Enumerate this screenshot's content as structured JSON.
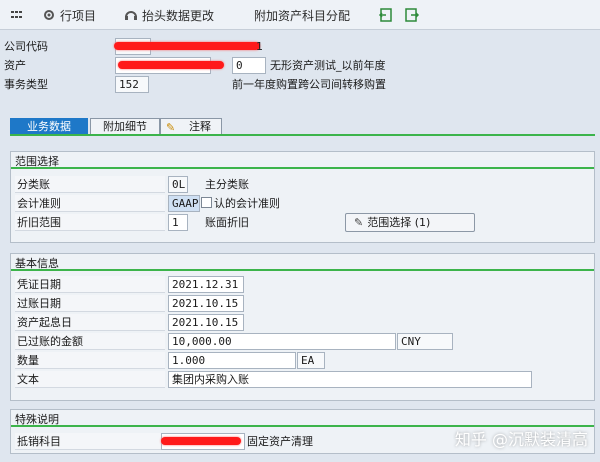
{
  "toolbar": {
    "line_items": "行项目",
    "header_change": "抬头数据更改",
    "additional_assignment": "附加资产科目分配"
  },
  "header": {
    "company_code_label": "公司代码",
    "company_code_suffix": "1",
    "asset_label": "资产",
    "asset_sub": "0",
    "asset_desc": "无形资产测试_以前年度",
    "transaction_type_label": "事务类型",
    "transaction_type_value": "152",
    "transaction_type_desc": "前一年度购置跨公司间转移购置"
  },
  "tabs": [
    {
      "label": "业务数据",
      "active": true
    },
    {
      "label": "附加细节",
      "active": false
    },
    {
      "label": "注释",
      "active": false
    }
  ],
  "scope": {
    "title": "范围选择",
    "ledger_group_label": "分类账",
    "ledger_group_value": "0L",
    "ledger_group_desc": "主分类账",
    "accounting_principle_label": "会计准则",
    "accounting_principle_value": "GAAP",
    "accounting_principle_desc": "认的会计准则",
    "depr_area_label": "折旧范围",
    "depr_area_value": "1",
    "depr_area_desc": "账面折旧",
    "range_button": "范围选择 (1)"
  },
  "basic": {
    "title": "基本信息",
    "doc_date_label": "凭证日期",
    "doc_date_value": "2021.12.31",
    "posting_date_label": "过账日期",
    "posting_date_value": "2021.10.15",
    "asset_value_date_label": "资产起息日",
    "asset_value_date_value": "2021.10.15",
    "amount_label": "已过账的金额",
    "amount_value": "10,000.00",
    "currency": "CNY",
    "quantity_label": "数量",
    "quantity_value": "1.000",
    "unit": "EA",
    "text_label": "文本",
    "text_value": "集团内采购入账"
  },
  "special": {
    "title": "特殊说明",
    "offset_label": "抵销科目",
    "offset_desc": "固定资产清理"
  },
  "watermark": "知乎 @沉默装清高"
}
